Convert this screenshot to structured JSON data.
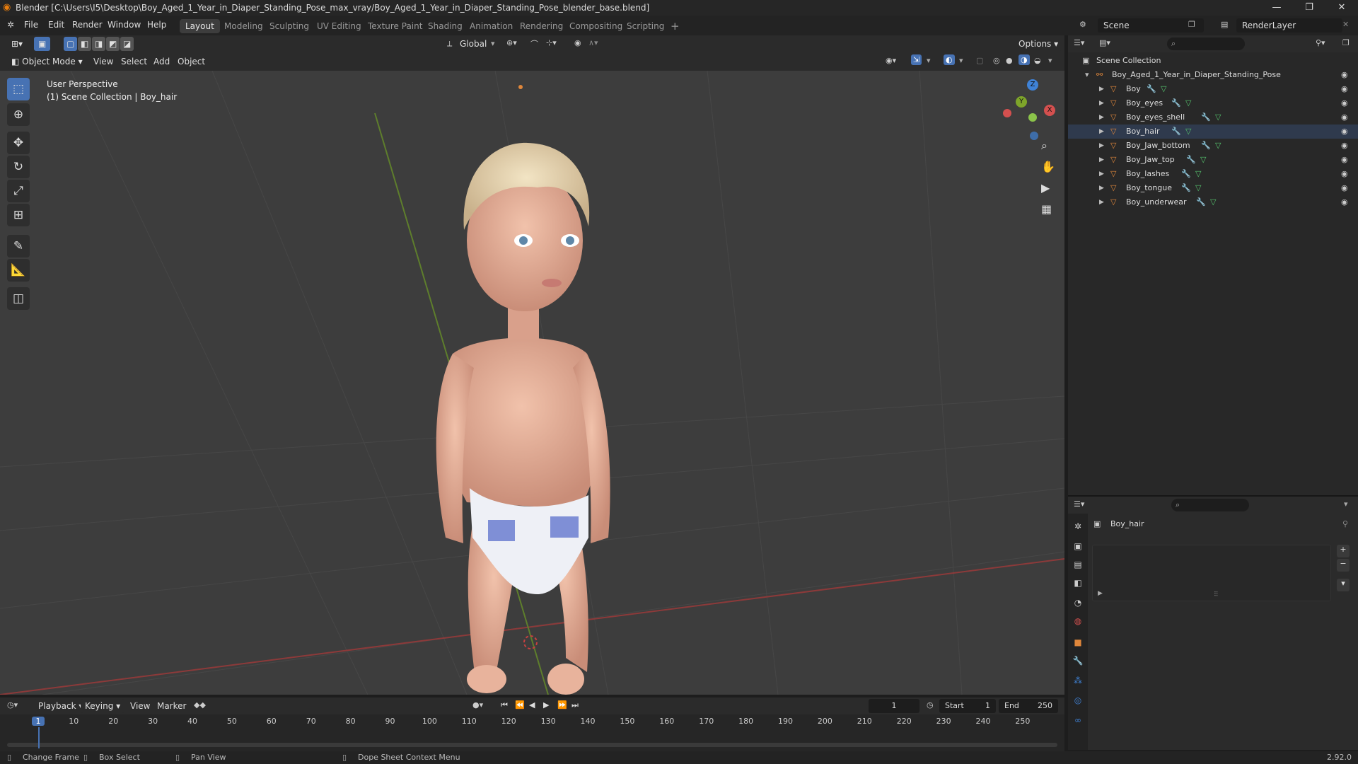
{
  "window": {
    "title": "Blender [C:\\Users\\I5\\Desktop\\Boy_Aged_1_Year_in_Diaper_Standing_Pose_max_vray/Boy_Aged_1_Year_in_Diaper_Standing_Pose_blender_base.blend]",
    "minimize": "—",
    "maximize": "❐",
    "close": "✕"
  },
  "menu": [
    "File",
    "Edit",
    "Render",
    "Window",
    "Help"
  ],
  "workspaces": [
    "Layout",
    "Modeling",
    "Sculpting",
    "UV Editing",
    "Texture Paint",
    "Shading",
    "Animation",
    "Rendering",
    "Compositing",
    "Scripting"
  ],
  "active_workspace": "Layout",
  "scene": {
    "label": "Scene",
    "render_layer": "RenderLayer"
  },
  "toolbar": {
    "orientation": "Global",
    "options": "Options"
  },
  "viewport_header": {
    "mode": "Object Mode",
    "menus": [
      "View",
      "Select",
      "Add",
      "Object"
    ]
  },
  "viewport": {
    "perspective": "User Perspective",
    "collection_info": "(1) Scene Collection | Boy_hair",
    "gizmo": {
      "z": "Z",
      "y": "Y",
      "x": "X"
    }
  },
  "outliner": {
    "root": "Scene Collection",
    "collection": "Boy_Aged_1_Year_in_Diaper_Standing_Pose",
    "items": [
      "Boy",
      "Boy_eyes",
      "Boy_eyes_shell",
      "Boy_hair",
      "Boy_Jaw_bottom",
      "Boy_Jaw_top",
      "Boy_lashes",
      "Boy_tongue",
      "Boy_underwear"
    ],
    "selected": "Boy_hair"
  },
  "properties": {
    "object_name": "Boy_hair"
  },
  "timeline": {
    "menus": [
      "Playback",
      "Keying",
      "View",
      "Marker"
    ],
    "current_frame": "1",
    "start_label": "Start",
    "start": "1",
    "end_label": "End",
    "end": "250",
    "ticks": [
      "1",
      "10",
      "20",
      "30",
      "40",
      "50",
      "60",
      "70",
      "80",
      "90",
      "100",
      "110",
      "120",
      "130",
      "140",
      "150",
      "160",
      "170",
      "180",
      "190",
      "200",
      "210",
      "220",
      "230",
      "240",
      "250"
    ]
  },
  "statusbar": {
    "change_frame": "Change Frame",
    "box_select": "Box Select",
    "pan_view": "Pan View",
    "context_menu": "Dope Sheet Context Menu",
    "version": "2.92.0"
  },
  "colors": {
    "accent": "#4772b3",
    "x_axis": "#d4504f",
    "y_axis": "#7ea52a",
    "z_axis": "#3f82d6",
    "object_orange": "#e0873b"
  }
}
